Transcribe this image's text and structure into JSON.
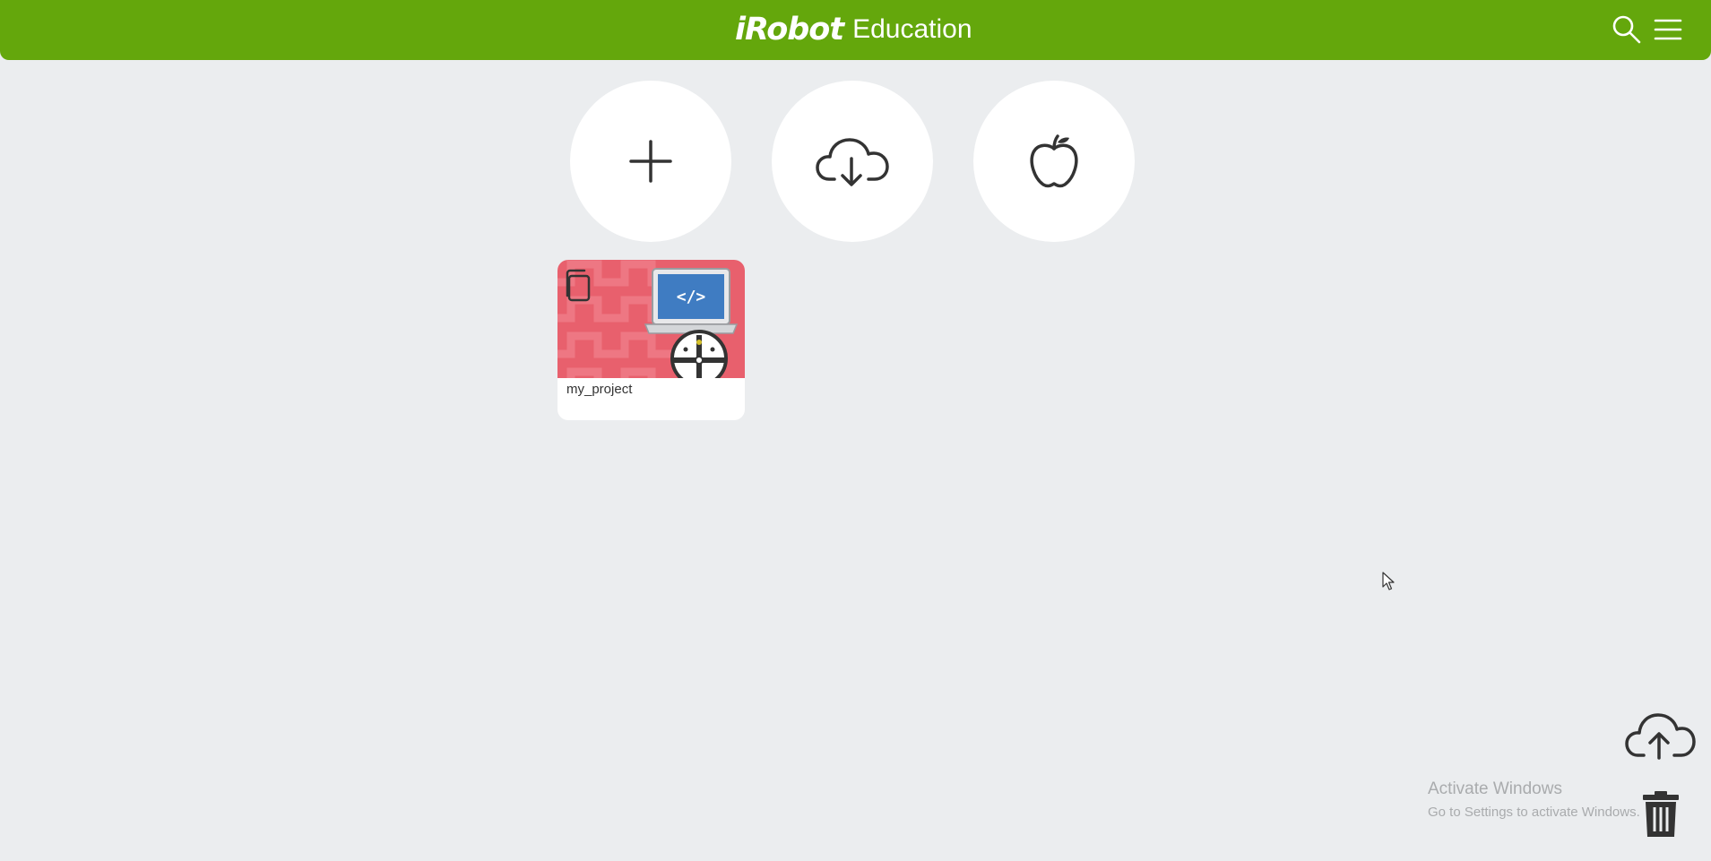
{
  "header": {
    "brand": "iRobot",
    "product": "Education",
    "icons": [
      "search-icon",
      "menu-icon"
    ],
    "background": "#64a70c"
  },
  "actions": [
    {
      "name": "new-project",
      "icon": "plus-icon"
    },
    {
      "name": "import-from-cloud",
      "icon": "cloud-download-icon"
    },
    {
      "name": "lessons",
      "icon": "apple-icon"
    }
  ],
  "projects": [
    {
      "title": "my_project",
      "thumbnail_color": "#e8606d",
      "icons": [
        "copy-icon",
        "laptop-code-icon",
        "robot-icon"
      ]
    }
  ],
  "tools": [
    {
      "name": "cloud-upload",
      "icon": "cloud-upload-icon"
    },
    {
      "name": "trash",
      "icon": "trash-icon"
    }
  ],
  "watermark": {
    "title": "Activate Windows",
    "subtitle": "Go to Settings to activate Windows."
  },
  "colors": {
    "page_background": "#ebedef",
    "icon_stroke": "#333333",
    "accent_green": "#64a70c"
  }
}
